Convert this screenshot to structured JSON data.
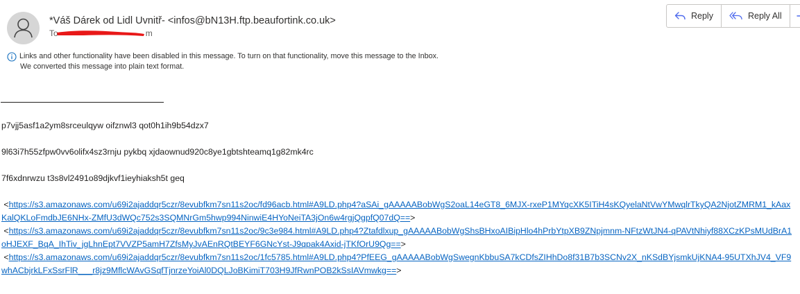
{
  "header": {
    "sender": "*Váš Dárek od Lidl Uvnitř- <infos@bN13H.ftp.beaufortink.co.uk>",
    "to_label": "To",
    "to_suffix": "m"
  },
  "actions": {
    "reply_label": "Reply",
    "reply_all_label": "Reply All",
    "forward_icon": "forward-arrow-icon"
  },
  "info_bar": {
    "icon": "info-icon",
    "line1": "Links and other functionality have been disabled in this message. To turn on that functionality, move this message to the Inbox.",
    "line2": "We converted this message into plain text format."
  },
  "body": {
    "paragraphs": [
      "p7vjj5asf1a2ym8srceulqyw oifznwl3 qot0h1ih9b54dzx7",
      "9l63i7h55zfpw0vv6olifx4sz3rnju pykbq xjdaownud920c8ye1gbtshteamq1g82mk4rc",
      "7f6xdnrwzu t3s8vl2491o89djkvf1ieyhiaksh5t geq"
    ],
    "links": [
      {
        "open": "<",
        "text": "https://s3.amazonaws.com/u69i2ajaddqr5czr/8evubfkm7sn11s2oc/fd96acb.html#A9LD.php4?aSAi_gAAAAABobWgS2oaL14eGT8_6MJX-rxeP1MYqcXK5ITiH4sKQyelaNtVwYMwqlrTkyQA2NjotZMRM1_kAaxKalQKLoFmdbJE6NHx-ZMfU3dWQc752s3SQMNrGm5hwp994NinwiE4HYoNeiTA3jOn6w4rgjQgpfQ07dQ==",
        "close": ">"
      },
      {
        "open": "<",
        "text": "https://s3.amazonaws.com/u69i2ajaddqr5czr/8evubfkm7sn11s2oc/9c3e984.html#A9LD.php4?Ztafdlxup_gAAAAABobWgShsBHxoAIBipHlo4hPrbYtpXB9ZNpjmnm-NFtzWtJN4-qPAVtNhiyf88XCzKPsMUdBrA1oHJEXF_BqA_IhTiv_jgLhnEpt7VVZP5amH7ZfsMyJvAEnRQtBEYF6GNcYst-J9qpak4Axid-jTKfOrU9Qg==",
        "close": ">"
      },
      {
        "open": "<",
        "text": "https://s3.amazonaws.com/u69i2ajaddqr5czr/8evubfkm7sn11s2oc/1fc5785.html#A9LD.php4?PfEEG_gAAAAABobWgSwegnKbbuSA7kCDfsZIHhDo8f31B7b3SCNv2X_nKSdBYjsmkUjKNA4-95UTXhJV4_VF9whACbjrkLFxSsrFlR___r8jz9MflcWAvGSqfTjnrzeYoiAl0DQLJoBKimiT703H9JfRwnPOB2kSsIAVmwkg==",
        "close": ">"
      }
    ]
  },
  "colors": {
    "link": "#0563c1",
    "accent": "#4f6bed",
    "redaction": "#e81818"
  }
}
